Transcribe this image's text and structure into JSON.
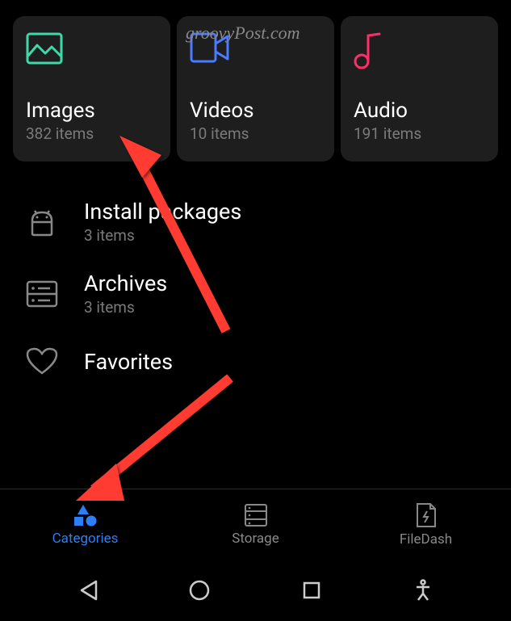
{
  "watermark": "groovyPost.com",
  "cards": [
    {
      "title": "Images",
      "count": "382 items",
      "icon": "image-icon",
      "color": "#3dd9a8"
    },
    {
      "title": "Videos",
      "count": "10 items",
      "icon": "video-icon",
      "color": "#4b7bff"
    },
    {
      "title": "Audio",
      "count": "191 items",
      "icon": "audio-icon",
      "color": "#ff2d6b"
    }
  ],
  "list": [
    {
      "title": "Install packages",
      "count": "3 items",
      "icon": "android-icon"
    },
    {
      "title": "Archives",
      "count": "3 items",
      "icon": "archive-icon"
    },
    {
      "title": "Favorites",
      "count": "",
      "icon": "heart-icon"
    }
  ],
  "tabs": [
    {
      "label": "Categories",
      "icon": "categories-icon",
      "active": true
    },
    {
      "label": "Storage",
      "icon": "storage-icon",
      "active": false
    },
    {
      "label": "FileDash",
      "icon": "filedash-icon",
      "active": false
    }
  ]
}
